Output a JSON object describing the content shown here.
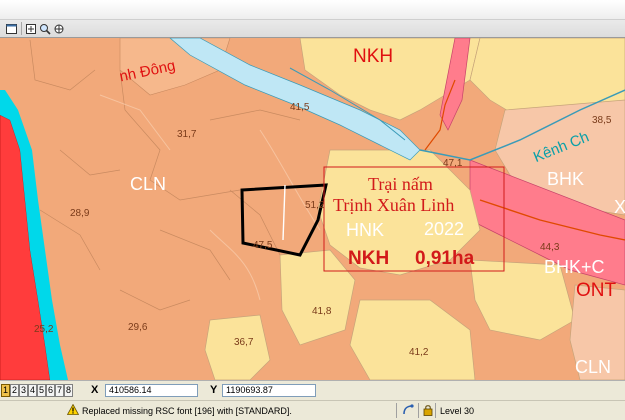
{
  "toolbar": {
    "buttons": [
      {
        "name": "window-icon"
      },
      {
        "name": "fit-view-icon"
      },
      {
        "name": "zoom-icon"
      },
      {
        "name": "pan-icon"
      }
    ]
  },
  "map": {
    "labels": {
      "road_name": "nh Đông",
      "canal_name": "Kênh Ch",
      "nkh_top": "NKH",
      "cln_left": "CLN",
      "cln_bottom_right": "CLN",
      "bhk_right": "BHK",
      "bhk_c": "BHK+C",
      "ont": "ONT",
      "hnk": "HNK",
      "title_line1": "Trại nấm",
      "title_line2": "Trịnh Xuân Linh",
      "year": "2022",
      "nkh_main": "NKH",
      "area": "0,91ha",
      "x_mark": "X"
    },
    "elevations": [
      "41,5",
      "31,7",
      "28,9",
      "51,2",
      "47,5",
      "47,1",
      "38,5",
      "44,3",
      "41,8",
      "36,7",
      "41,2",
      "29,6",
      "25,2"
    ],
    "colors": {
      "cln_land": "#f2a97a",
      "hnk_land": "#fbe39a",
      "nkh_land": "#fbe39a",
      "bhk_land": "#f7c7a8",
      "ont_land": "#ff7c8c",
      "river": "#00d8ea",
      "red_area": "#ff3c3c",
      "label_red": "#e01010",
      "canal_text": "#0aa0a8"
    }
  },
  "coordbar": {
    "view_buttons": [
      "1",
      "2",
      "3",
      "4",
      "5",
      "6",
      "7",
      "8"
    ],
    "active_view": "1",
    "x_label": "X",
    "x_value": "410586.14",
    "y_label": "Y",
    "y_value": "1190693.87"
  },
  "statusbar": {
    "message": "Replaced missing RSC font [196] with [STANDARD].",
    "level": "Level 30"
  }
}
